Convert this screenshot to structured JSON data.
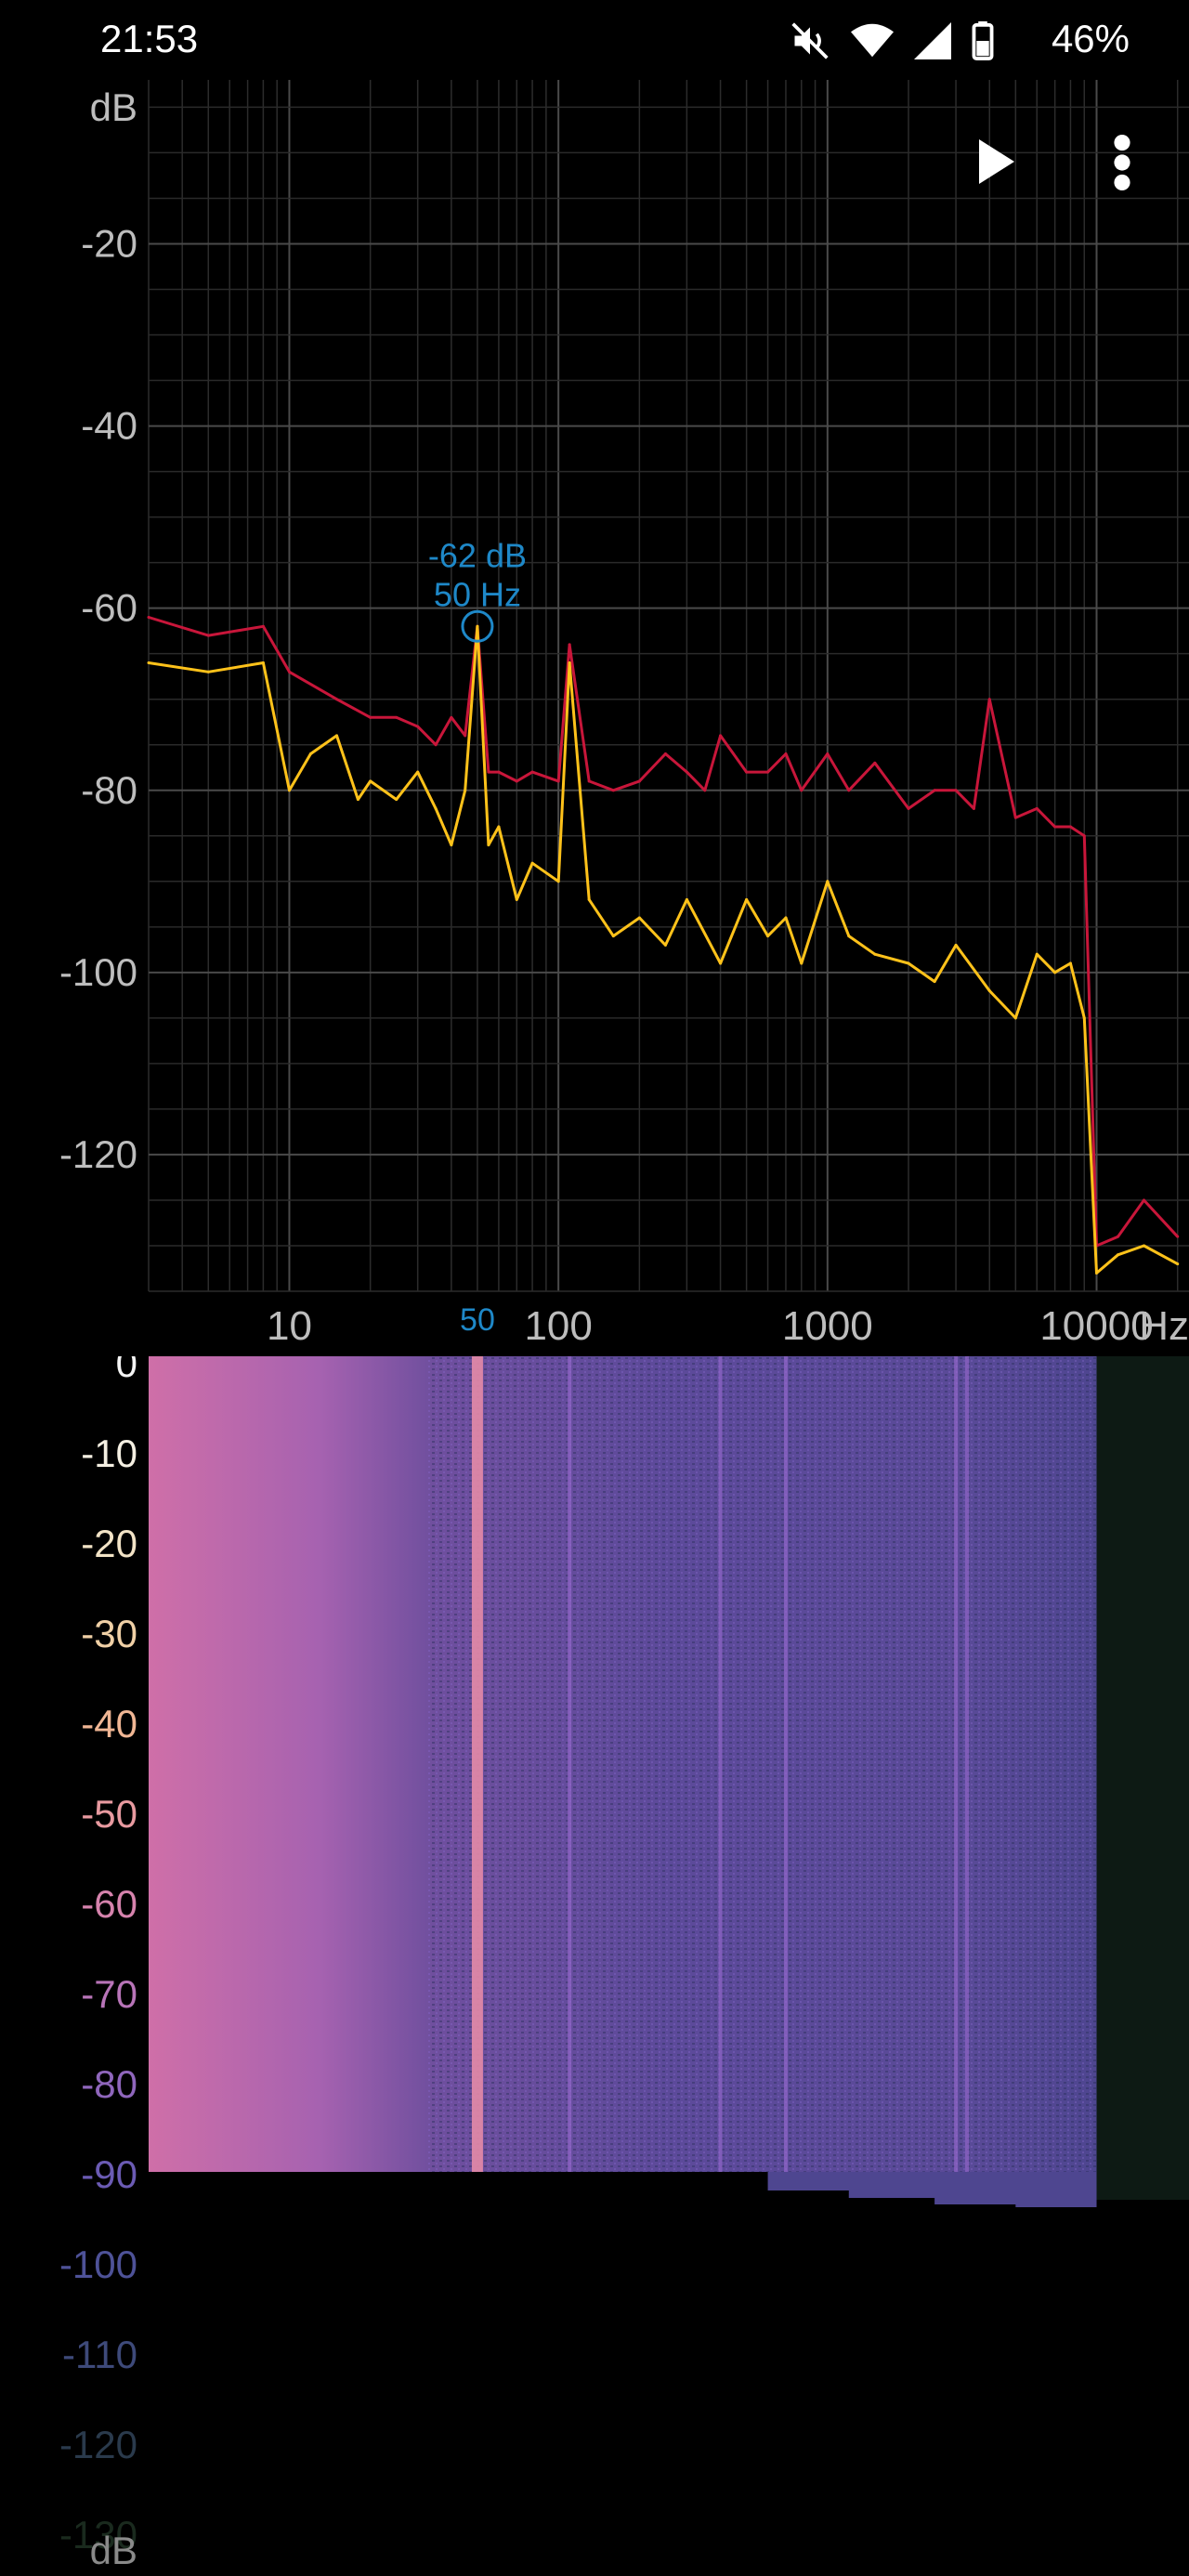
{
  "status_bar": {
    "time": "21:53",
    "battery": "46%",
    "icons": [
      "mute-icon",
      "wifi-icon",
      "signal-icon",
      "battery-icon"
    ]
  },
  "toolbar": {
    "play_icon": "play-icon",
    "menu_icon": "more-vert-icon"
  },
  "chart_data": [
    {
      "type": "line",
      "title": "",
      "xscale": "log",
      "xlim": [
        3,
        22050
      ],
      "ylim": [
        -135,
        -2
      ],
      "ylabel": "dB",
      "xlabel": "Hz",
      "y_ticks": [
        -20,
        -40,
        -60,
        -80,
        -100,
        -120
      ],
      "y_tick_labels": [
        "-20",
        "-40",
        "-60",
        "-80",
        "-100",
        "-120"
      ],
      "x_tick_labels": [
        "10",
        "100",
        "1000",
        "10000"
      ],
      "x_ticks": [
        10,
        100,
        1000,
        10000
      ],
      "marker": {
        "freq": 50,
        "freq_label": "50",
        "value_label": "-62 dB",
        "freq_text": "50 Hz",
        "db": -62
      },
      "colors": {
        "peak_series": "#c8163a",
        "live_series": "#ffc21a",
        "marker": "#1e88c8",
        "grid": "#3a3a3a"
      },
      "series": [
        {
          "color": "#c8163a",
          "x": [
            3,
            5,
            8,
            10,
            15,
            20,
            25,
            30,
            35,
            40,
            45,
            50,
            55,
            60,
            70,
            80,
            100,
            110,
            130,
            160,
            200,
            250,
            300,
            350,
            400,
            500,
            600,
            700,
            800,
            1000,
            1200,
            1500,
            2000,
            2500,
            3000,
            3500,
            4000,
            5000,
            6000,
            7000,
            8000,
            9000,
            10000,
            12000,
            15000,
            20000
          ],
          "y": [
            -61,
            -63,
            -62,
            -67,
            -70,
            -72,
            -72,
            -73,
            -75,
            -72,
            -74,
            -62,
            -78,
            -78,
            -79,
            -78,
            -79,
            -64,
            -79,
            -80,
            -79,
            -76,
            -78,
            -80,
            -74,
            -78,
            -78,
            -76,
            -80,
            -76,
            -80,
            -77,
            -82,
            -80,
            -80,
            -82,
            -70,
            -83,
            -82,
            -84,
            -84,
            -85,
            -130,
            -129,
            -125,
            -129
          ]
        },
        {
          "color": "#ffc21a",
          "x": [
            3,
            5,
            8,
            10,
            12,
            15,
            18,
            20,
            25,
            30,
            35,
            40,
            45,
            50,
            55,
            60,
            70,
            80,
            100,
            110,
            130,
            160,
            200,
            250,
            300,
            400,
            500,
            600,
            700,
            800,
            1000,
            1200,
            1500,
            2000,
            2500,
            3000,
            4000,
            5000,
            6000,
            7000,
            8000,
            9000,
            10000,
            12000,
            15000,
            20000
          ],
          "y": [
            -66,
            -67,
            -66,
            -80,
            -76,
            -74,
            -81,
            -79,
            -81,
            -78,
            -82,
            -86,
            -80,
            -62,
            -86,
            -84,
            -92,
            -88,
            -90,
            -66,
            -92,
            -96,
            -94,
            -97,
            -92,
            -99,
            -92,
            -96,
            -94,
            -99,
            -90,
            -96,
            -98,
            -99,
            -101,
            -97,
            -102,
            -105,
            -98,
            -100,
            -99,
            -105,
            -133,
            -131,
            -130,
            -132
          ]
        }
      ]
    },
    {
      "type": "heatmap",
      "title": "",
      "ylabel": "dB",
      "color_scale_ticks": [
        0,
        -10,
        -20,
        -30,
        -40,
        -50,
        -60,
        -70,
        -80,
        -90,
        -100,
        -110,
        -120,
        -130
      ],
      "color_scale_labels": [
        "0",
        "-10",
        "-20",
        "-30",
        "-40",
        "-50",
        "-60",
        "-70",
        "-80",
        "-90",
        "-100",
        "-110",
        "-120",
        "-130"
      ],
      "colors": [
        "#f2f2f2",
        "#f5e6c8",
        "#f2b48c",
        "#e8809a",
        "#a060b0",
        "#6a55a8",
        "#3a3f7a",
        "#23344a",
        "#12221a"
      ]
    }
  ]
}
